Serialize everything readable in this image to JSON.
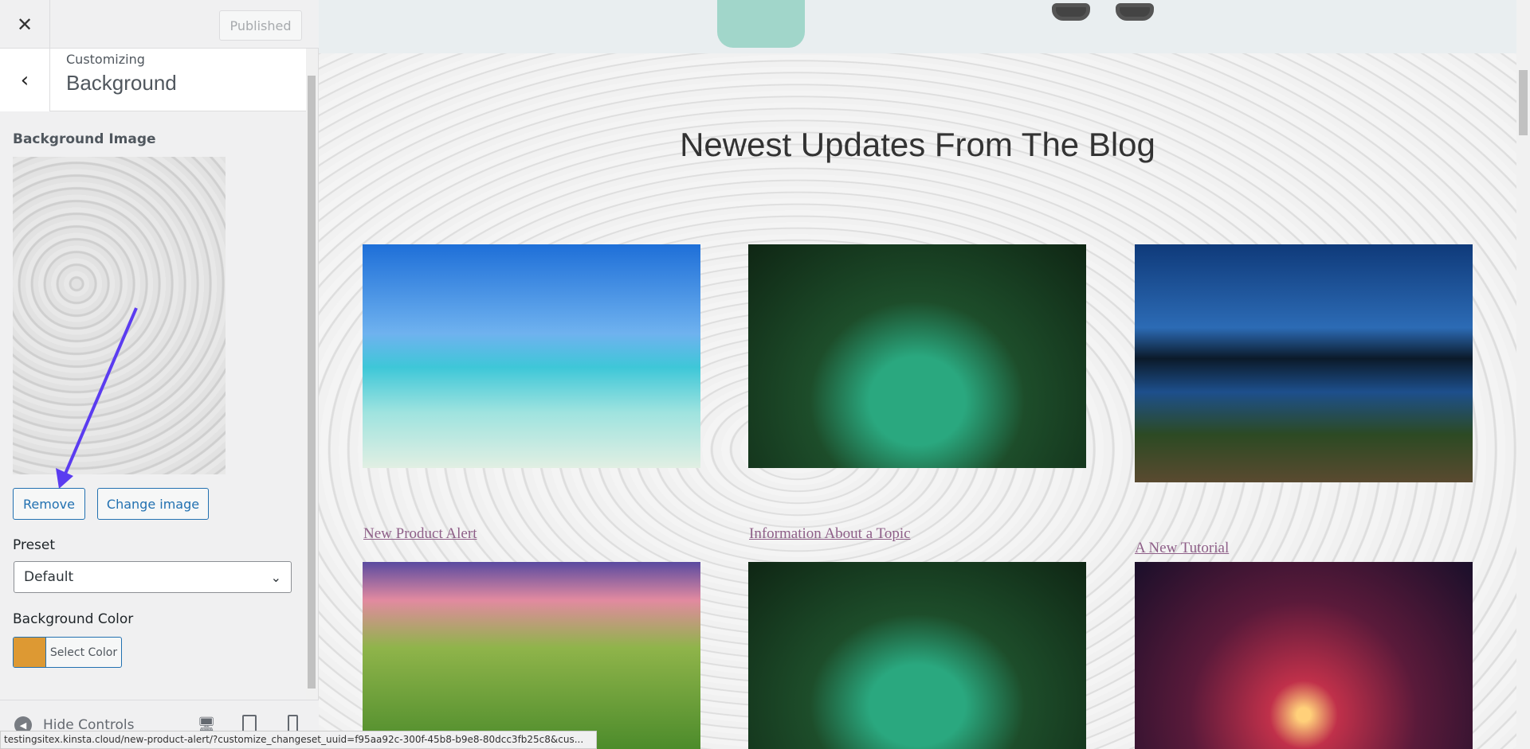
{
  "sidebar": {
    "close_label": "✕",
    "publish_label": "Published",
    "back_label": "‹",
    "customizing": "Customizing",
    "section_title": "Background",
    "background_image_label": "Background Image",
    "remove_label": "Remove",
    "change_image_label": "Change image",
    "preset_label": "Preset",
    "preset_value": "Default",
    "background_color_label": "Background Color",
    "background_color": "#dd9933",
    "select_color_label": "Select Color",
    "hide_controls_label": "Hide Controls",
    "devices": [
      "desktop",
      "tablet",
      "mobile"
    ]
  },
  "status_bar": "testingsitex.kinsta.cloud/new-product-alert/?customize_changeset_uuid=f95aa92c-300f-45b8-b9e8-80dcc3fb25c8&cus...",
  "preview": {
    "heading": "Newest Updates From The Blog",
    "posts": [
      {
        "title": "New Product Alert",
        "image": "tropical-beach"
      },
      {
        "title": "Information About a Topic",
        "image": "forest-river"
      },
      {
        "title": "A New Tutorial",
        "image": "lake-pier-night"
      }
    ],
    "row2_images": [
      "waterfall-sunset",
      "forest-river",
      "tree-red-sky"
    ]
  },
  "colors": {
    "accent": "#2271b1",
    "link": "#8e5f88",
    "annotation_arrow": "#5b3cf0"
  }
}
